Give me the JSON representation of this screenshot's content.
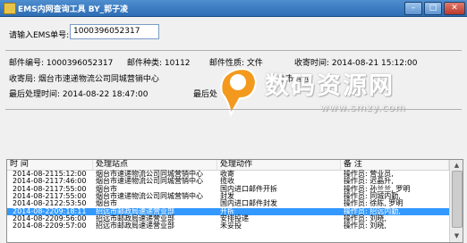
{
  "window": {
    "title": "EMS内网查询工具 BY_郭子凌",
    "minimize": "–",
    "maximize": "□",
    "close": "✕"
  },
  "query": {
    "label": "请输入EMS单号:",
    "value": "1000396052317"
  },
  "info": {
    "mail_no": "邮件编号: 1000396052317",
    "mail_type": "邮件种类: 10112",
    "mail_nature": "邮件性质: 文件",
    "collect_time": "收寄时间: 2014-08-21 15:12:00",
    "collect_office": "收寄局: 烟台市速递物流公司同城营销中心",
    "delivery": "寄",
    "delivery_partial": "台市招远",
    "last_time": "最后处理时间: 2014-08-22 18:47:00",
    "last_place": "最后处"
  },
  "watermark": {
    "brand": "数码资源网",
    "url": "www.smzy.com"
  },
  "table": {
    "columns": [
      "时 间",
      "处理站点",
      "处理动作",
      "备 注"
    ],
    "rows": [
      [
        "2014-08-2115:12:00",
        "烟台市速递物流公司同城营销中心",
        "收寄",
        "操作员: 营业员,"
      ],
      [
        "2014-08-2117:46:00",
        "烟台市速递物流公司同城营销中心",
        "揽收",
        "操作员: 迟晶升,"
      ],
      [
        "2014-08-2117:55:00",
        "烟台市",
        "国内进口邮件开拆",
        "操作员: 孙兰兰, 罗明"
      ],
      [
        "2014-08-2117:55:00",
        "烟台市速递物流公司同城营销中心",
        "封发",
        "操作员: 同城内勤,"
      ],
      [
        "2014-08-2122:53:50",
        "烟台市",
        "国内进口邮件封发",
        "操作员: 徐陈, 罗明"
      ],
      [
        "2014-08-2209:18:11",
        "招远市邮政局速递营业部",
        "开拆",
        "操作员: 招远内勤,"
      ],
      [
        "2014-08-2209:56:00",
        "招远市邮政局速递营业部",
        "安排投递",
        "操作员: 刘晓,"
      ],
      [
        "2014-08-2209:57:00",
        "招远市邮政局速递营业部",
        "未妥投",
        "操作员: 刘晓,"
      ]
    ],
    "selected_row": 5
  },
  "colors": {
    "title_bar": "#2d6db4",
    "selection": "#3399ff"
  }
}
